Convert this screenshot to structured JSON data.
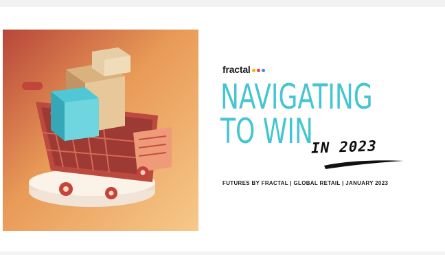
{
  "slide": {
    "logo_text": "fractal",
    "logo_dot_colors": [
      "#f4b400",
      "#e94335",
      "#4285f4"
    ],
    "title_line1": "NAVIGATING",
    "title_line2": "TO WIN",
    "title_line3": "IN 2023",
    "subtitle": "FUTURES BY FRACTAL  |  GLOBAL RETAIL  |  JANUARY 2023",
    "accent_color": "#45c5d3"
  }
}
